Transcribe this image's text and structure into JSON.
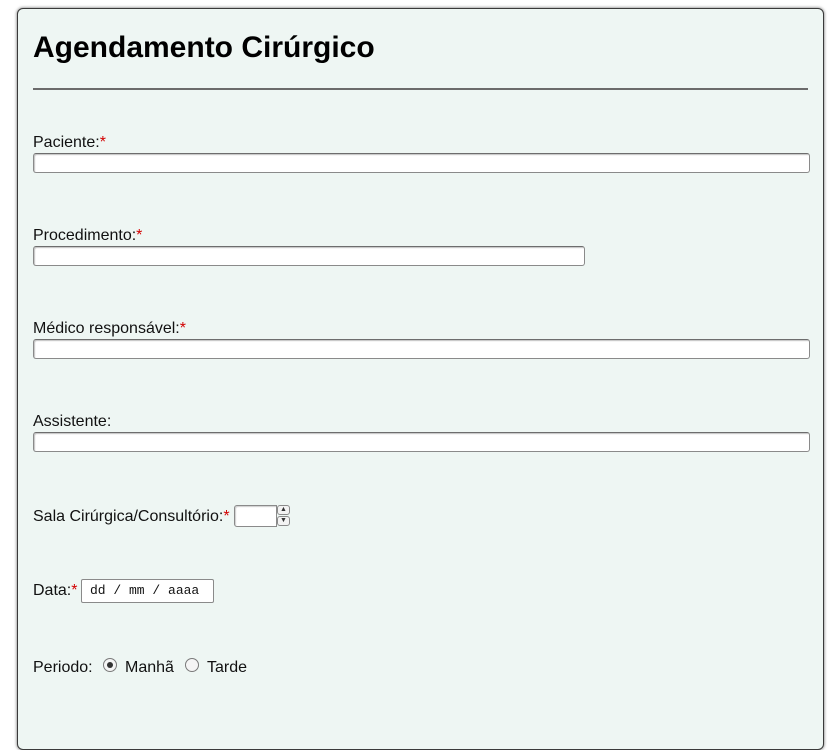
{
  "form": {
    "title": "Agendamento Cirúrgico",
    "required_mark": "*",
    "fields": {
      "paciente": {
        "label": "Paciente:",
        "value": "",
        "required": true
      },
      "procedimento": {
        "label": "Procedimento:",
        "value": "",
        "required": true
      },
      "medico": {
        "label": "Médico responsável:",
        "value": "",
        "required": true
      },
      "assistente": {
        "label": "Assistente:",
        "value": "",
        "required": false
      },
      "sala": {
        "label": "Sala Cirúrgica/Consultório:",
        "value": "",
        "required": true
      },
      "data": {
        "label": "Data:",
        "placeholder": "dd / mm / aaaa",
        "required": true
      }
    },
    "periodo": {
      "label": "Periodo:",
      "options": [
        "Manhã",
        "Tarde"
      ],
      "selected": "Manhã"
    }
  },
  "colors": {
    "panel_bg": "#eef6f3",
    "required": "#d20000",
    "divider": "#6b6b6b"
  },
  "icons": {
    "spin_up": "chevron-up-icon",
    "spin_down": "chevron-down-icon"
  }
}
